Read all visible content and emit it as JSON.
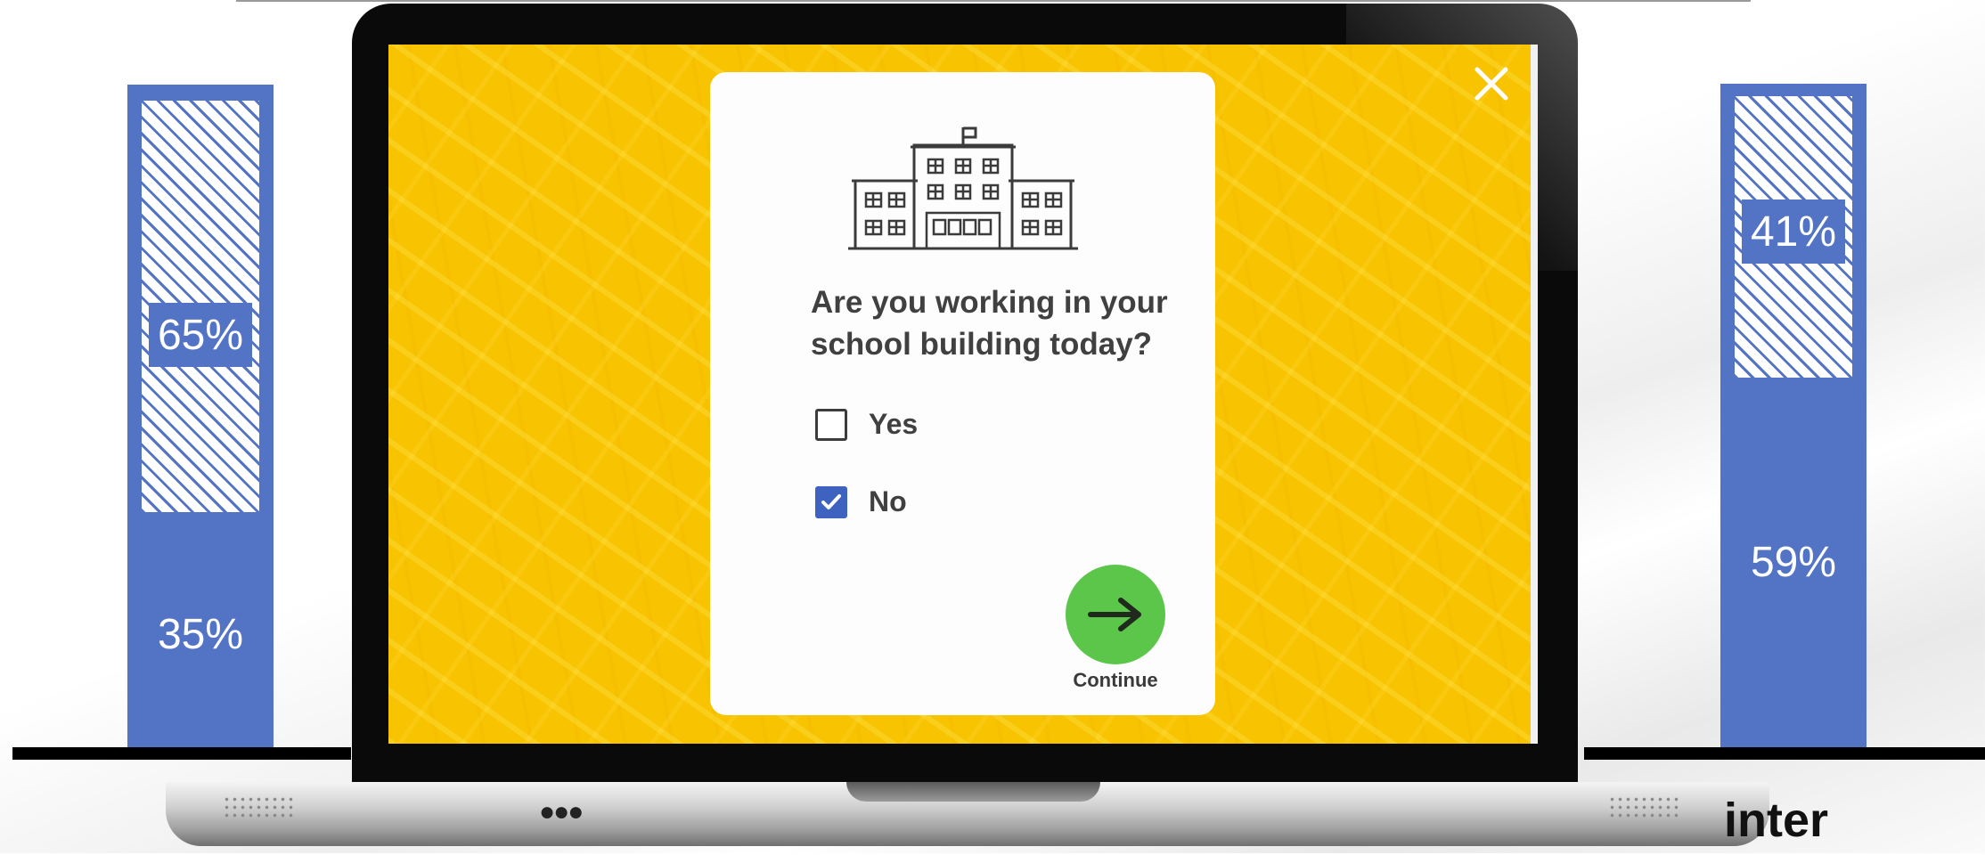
{
  "background_chart": {
    "left_bar": {
      "top_value": "65%",
      "bottom_value": "35%"
    },
    "right_bar": {
      "top_value": "41%",
      "bottom_value": "59%"
    },
    "visible_axis_label_fragment": "inter",
    "bar_color": "#5374c4"
  },
  "screen": {
    "background_color": "#f8c300",
    "close_icon": "close-icon"
  },
  "dialog": {
    "illustration_icon": "school-building-icon",
    "question": "Are you working in your school building today?",
    "options": [
      {
        "label": "Yes",
        "checked": false
      },
      {
        "label": "No",
        "checked": true
      }
    ],
    "continue_icon": "arrow-right-icon",
    "continue_label": "Continue",
    "continue_color": "#5cc64a",
    "checkbox_checked_color": "#3d62c0"
  }
}
